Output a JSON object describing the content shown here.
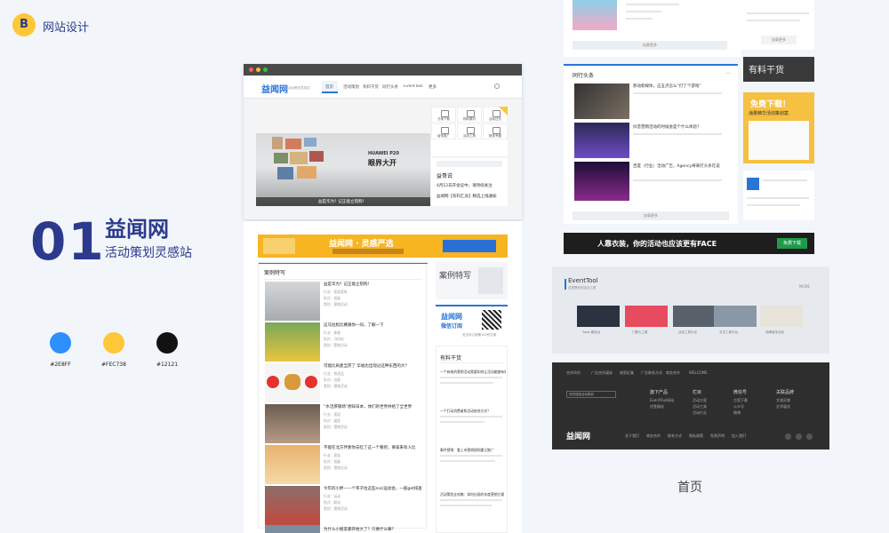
{
  "brand": {
    "badge": "B",
    "name": "网站设计"
  },
  "project": {
    "number": "01",
    "title": "益闻网",
    "subtitle": "活动策划灵感站"
  },
  "palette": [
    {
      "hex": "#2E8FFF",
      "label": "#2E8FF"
    },
    {
      "hex": "#FEC738",
      "label": "#FEC738"
    },
    {
      "hex": "#121212",
      "label": "#12121"
    }
  ],
  "page_label": "首页",
  "mock": {
    "logo": "益闻网",
    "logo_tag": "活动策划灵感站",
    "nav": [
      "首页",
      "活动策划",
      "有料干货",
      "同行头条",
      "EventTool",
      "更多"
    ],
    "hero_caption": "益是华为？记正能立刻购！",
    "grid": [
      "方案下载",
      "物料素材",
      "活动日历",
      "宣传推广",
      "活动工具",
      "精选专题"
    ],
    "yisay": "益哥说",
    "yisay_items": [
      "4月12日开会议中，请持续关注",
      "益闻网【有料汇总】精选上线通知"
    ],
    "banner": "益闻网 · 灵感严选",
    "case_section": "案例特写",
    "cases": [
      {
        "title": "益是华为？记正能立刻购！",
        "meta": [
          "行业：家居家电",
          "形式：巡展",
          "类别：营销活动"
        ]
      },
      {
        "title": "这马拉松比赛跟你一同，了解一下",
        "meta": [
          "行业：体育",
          "形式：马拉松",
          "类别：营销活动"
        ]
      },
      {
        "title": "可能比肩麦当劳了 华福也出现过这种东西的大？",
        "meta": [
          "行业：快消品",
          "形式：出版",
          "类别：营销活动"
        ]
      },
      {
        "title": "“水活厚钢场”想知日本，体们的世界并给了全世界",
        "meta": [
          "行业：家居",
          "形式：展览",
          "类别：营销活动"
        ]
      },
      {
        "title": "不能在北方伴奏你去吃了这一个看吧，要拿来有人比",
        "meta": [
          "行业：家居",
          "形式：巡展",
          "类别：营销活动"
        ]
      },
      {
        "title": "今年的小胖——个率子拉这些nsci运动会，一般get排查",
        "meta": [
          "行业：运动",
          "形式：联动",
          "类别：营销活动"
        ]
      },
      {
        "title": "为什么小朋友都开始大了？只要什么嘛？",
        "meta": []
      }
    ],
    "side_case": "案例特写",
    "wx": {
      "line1": "益闻网",
      "line2": "微信订阅",
      "note": "关注你订阅第100份方案"
    },
    "dry_section": "有料干货",
    "dry_items": [
      "一个有效的营销活动需要如何让活动能够有效",
      "一个打动消费者和活动结合方式？",
      "事件营销：看上市营销规则建立推广",
      "活动策划全攻略：如何出现的年度营销方案"
    ],
    "hot_section": "同行头条",
    "hot_items": [
      "移动新媒体，这五点怎么“打了个游戏”",
      "抖音营销活动的时候会是个什么体验？",
      "百度（行业）活动广告，Agency将来打头条在说"
    ],
    "more": "加载更多",
    "ad_right": [
      "有料干货",
      "免费下载！",
      "海量精华活动策划案"
    ],
    "yellow_ad": "人靠衣装，你的活动也应该更有FACE",
    "yellow_btn": "免费下载",
    "eventtool": {
      "title": "EventTool",
      "sub": "这里是你的活动工具",
      "more": "MORE"
    },
    "tools": [
      "Tools 服务台",
      "门数大工具",
      "活动工具平台",
      "文字工具平台",
      "品牌宣传活动"
    ],
    "footer": {
      "top": [
        "合作伙伴",
        "广告合作媒体",
        "商家征集",
        "广告联系方式",
        "商务合作",
        "WELCOME"
      ],
      "search": "请您搜索活动策划",
      "cols": [
        "旗下产品",
        "栏目",
        "微信号",
        "关联品牌"
      ],
      "col_items": [
        [
          "EventTool网站",
          "优胜精选"
        ],
        [
          "活动方案",
          "活动工具",
          "活动行业"
        ],
        [
          "方案下载",
          "公众号",
          "微博"
        ],
        [
          "文旅灵感",
          "艺术展览"
        ]
      ],
      "brand": "益闻网",
      "links": [
        "关于我们",
        "商务合作",
        "联系方式",
        "隐私政策",
        "免责声明",
        "加入我们",
        "网站地图"
      ]
    }
  }
}
